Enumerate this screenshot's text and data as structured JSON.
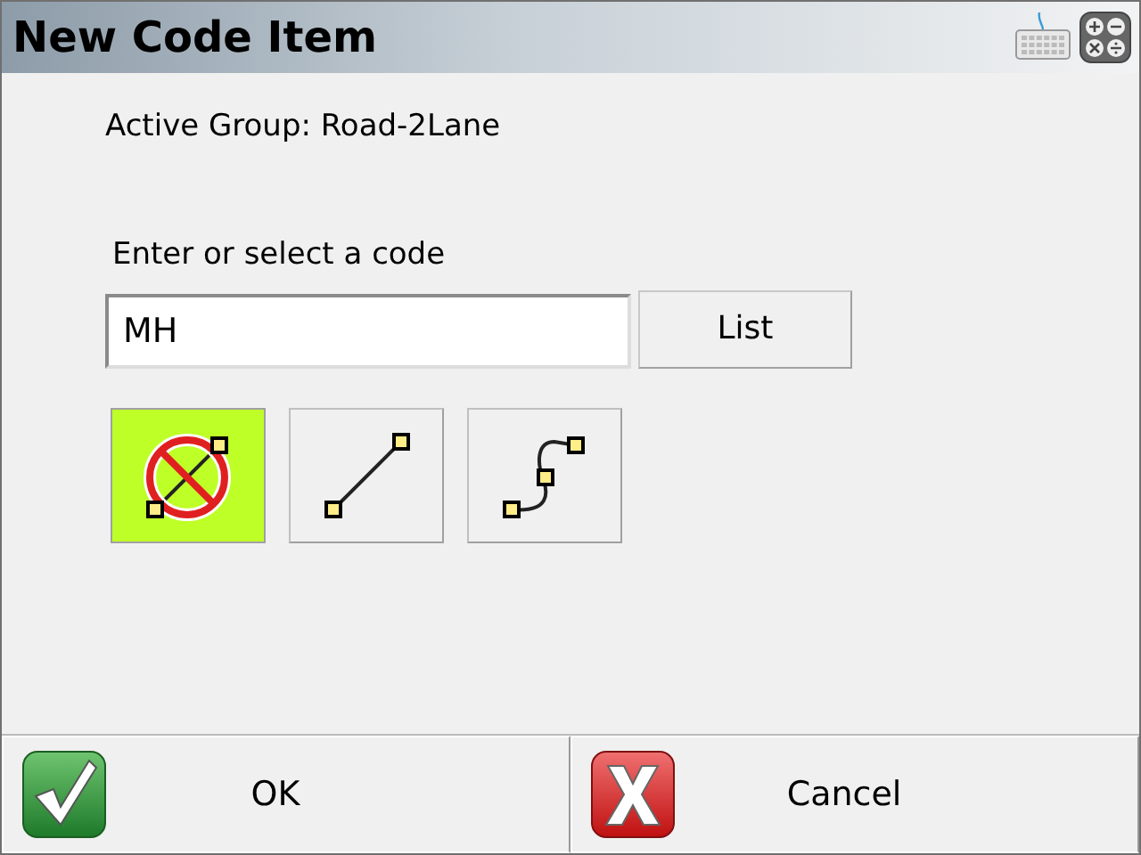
{
  "window": {
    "title": "New Code Item"
  },
  "active_group": "Active Group: Road-2Lane",
  "code_prompt": "Enter or select a code",
  "code_field": {
    "value": "MH"
  },
  "list_button": "List",
  "code_types": [
    {
      "kind": "point",
      "selected": true
    },
    {
      "kind": "line",
      "selected": false
    },
    {
      "kind": "curve",
      "selected": false
    }
  ],
  "buttons": [
    {
      "kind": "ok",
      "label": "OK"
    },
    {
      "kind": "cancel",
      "label": "Cancel"
    }
  ]
}
